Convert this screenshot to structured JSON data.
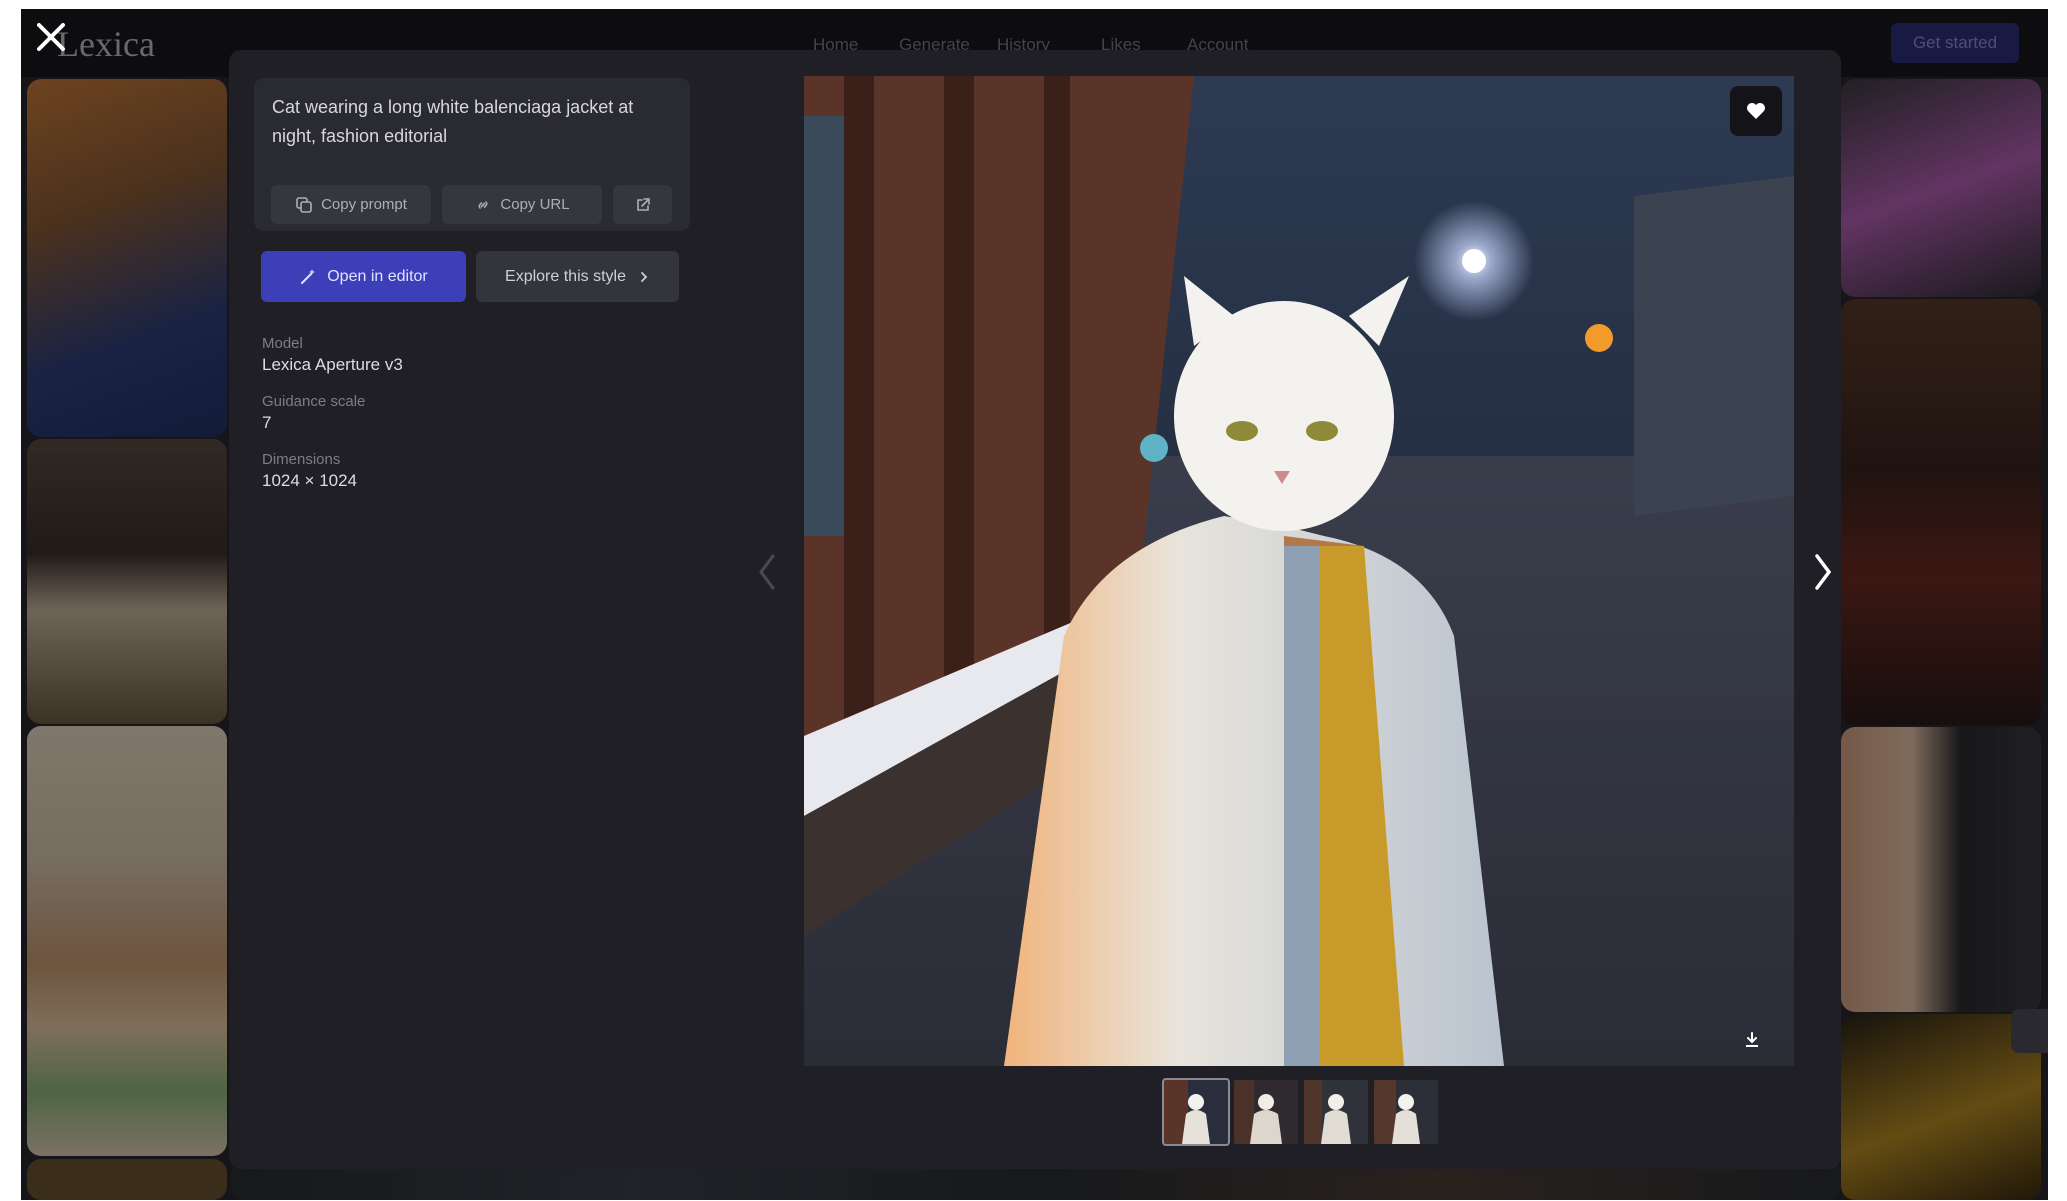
{
  "background_page": {
    "logo": "Lexica",
    "nav": [
      "Home",
      "Generate",
      "History",
      "Likes",
      "Account"
    ],
    "get_started": "Get started"
  },
  "modal": {
    "prompt": "Cat wearing a long white balenciaga jacket at night, fashion editorial",
    "copy_prompt": "Copy prompt",
    "copy_url": "Copy URL",
    "open_in_editor": "Open in editor",
    "explore_style": "Explore this style",
    "details": [
      {
        "label": "Model",
        "value": "Lexica Aperture v3"
      },
      {
        "label": "Guidance scale",
        "value": "7"
      },
      {
        "label": "Dimensions",
        "value": "1024 × 1024"
      }
    ],
    "thumbnail_count": 4,
    "selected_thumbnail": 1
  },
  "icons": {
    "close": "close-icon",
    "copy": "copy-icon",
    "link": "link-icon",
    "external": "external-link-icon",
    "wand": "magic-wand-icon",
    "chevron_right": "chevron-right-icon",
    "chevron_left": "chevron-left-icon",
    "heart": "heart-icon",
    "download": "download-icon"
  },
  "colors": {
    "modal_bg": "#1f1f25",
    "primary_button": "#3c3fb8",
    "card_bg": "#2a2a31"
  }
}
